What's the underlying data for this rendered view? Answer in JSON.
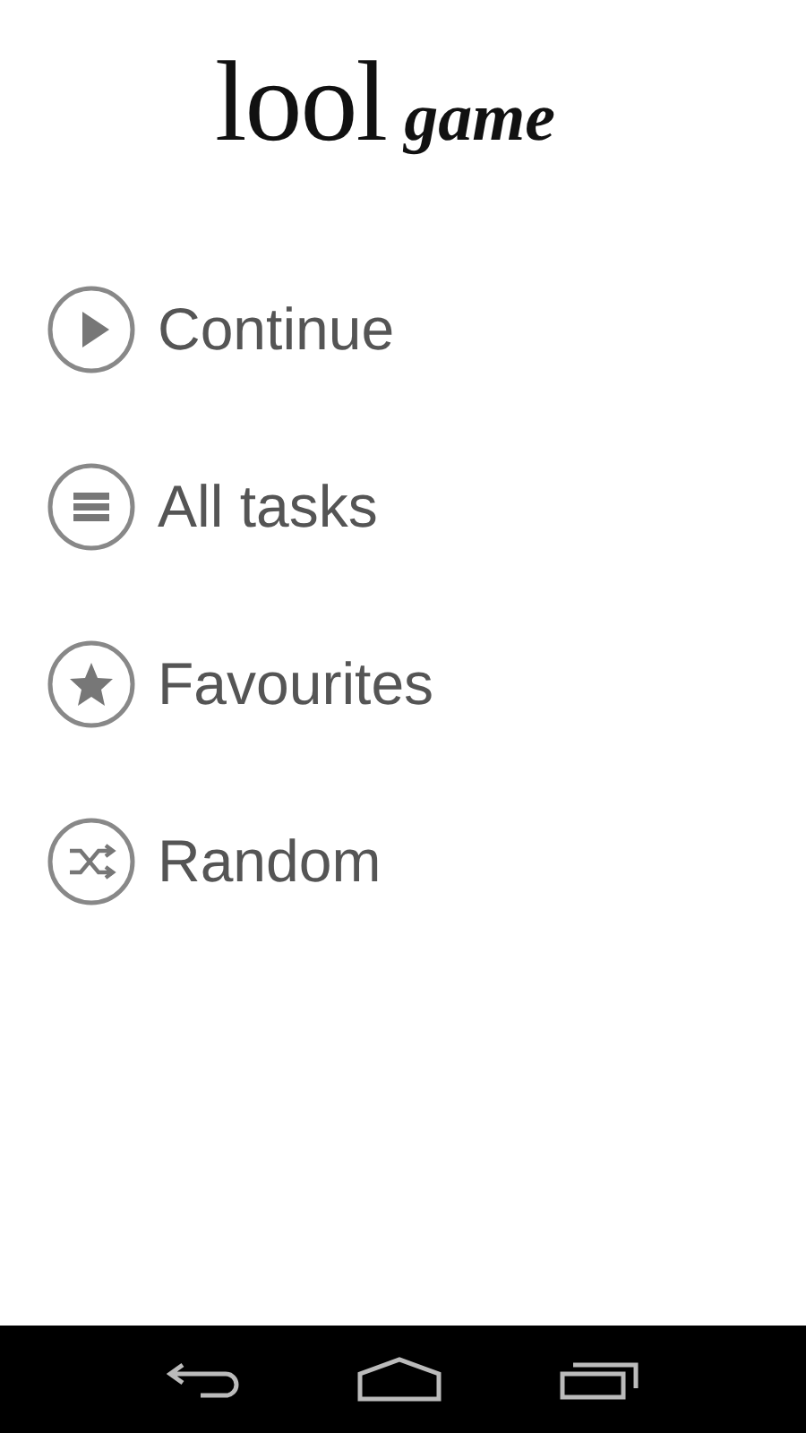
{
  "logo": {
    "main": "lool",
    "sub": "game"
  },
  "menu": [
    {
      "label": "Continue",
      "kind": "play"
    },
    {
      "label": "All tasks",
      "kind": "list"
    },
    {
      "label": "Favourites",
      "kind": "star"
    },
    {
      "label": "Random",
      "kind": "shuffle"
    }
  ],
  "nav_bar": [
    {
      "kind": "back"
    },
    {
      "kind": "home"
    },
    {
      "kind": "recents"
    }
  ]
}
